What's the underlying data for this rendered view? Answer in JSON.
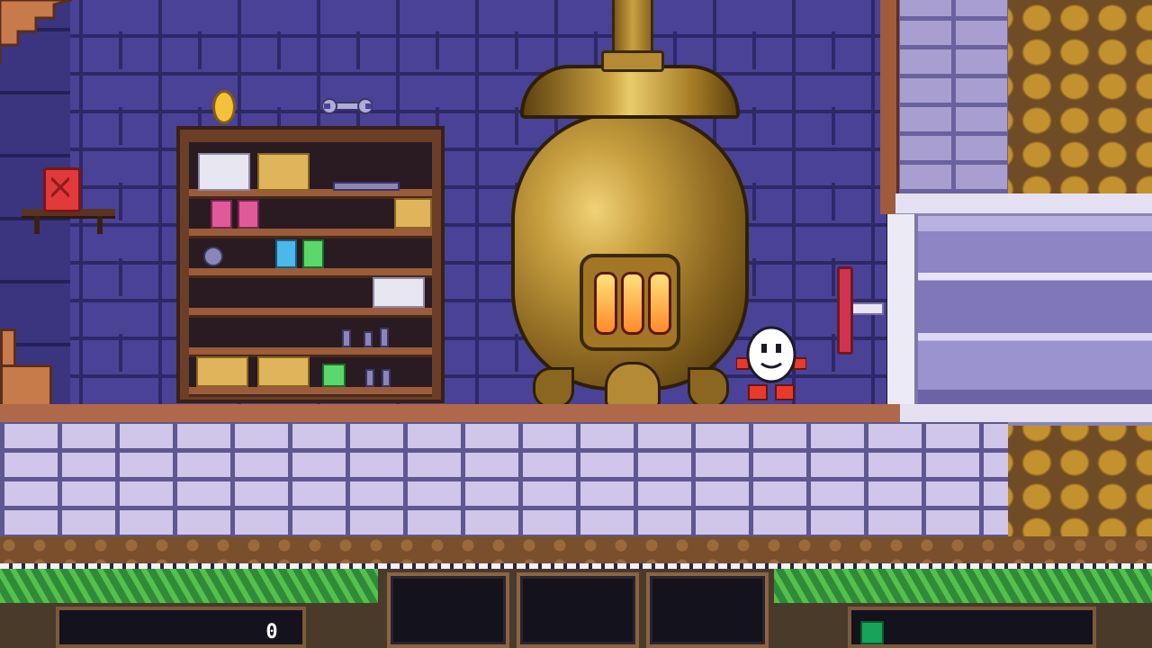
{
  "scene": {
    "room": "boiler-room",
    "colors": {
      "wall": "#4a4296",
      "floor": "#cfc6ea",
      "boiler": "#c9a040",
      "hud_frame": "#8b6442",
      "energy": "#17a35a"
    }
  },
  "items": {
    "coin_icon": "coin-icon",
    "wrench_icon": "wrench-icon",
    "jerry_can_icon": "jerry-can-icon",
    "lever_icon": "lever-icon"
  },
  "hud": {
    "lives_display": "0",
    "inventory_slots": 3,
    "energy_color": "#17a35a"
  }
}
